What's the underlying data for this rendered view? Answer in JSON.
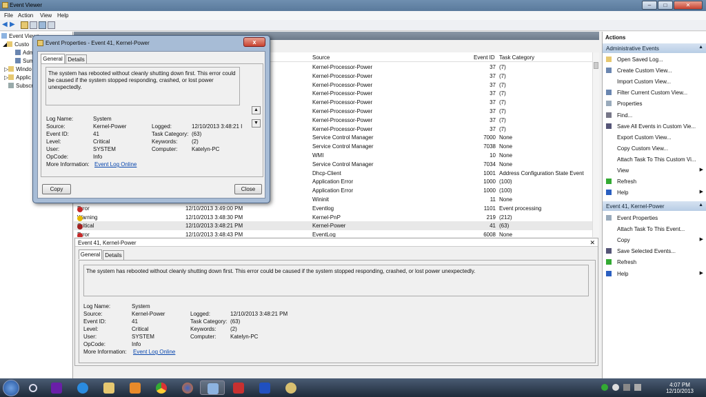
{
  "window": {
    "title": "Event Viewer"
  },
  "menu": [
    "File",
    "Action",
    "View",
    "Help"
  ],
  "tree": [
    {
      "label": "Event Viewe",
      "indent": 2
    },
    {
      "label": "Custo",
      "indent": 10
    },
    {
      "label": "Admi",
      "indent": 22
    },
    {
      "label": "Sum",
      "indent": 22
    },
    {
      "label": "Windo",
      "indent": 10
    },
    {
      "label": "Applic",
      "indent": 10
    },
    {
      "label": "Subscri",
      "indent": 10
    }
  ],
  "grid": {
    "columns": {
      "source": "Source",
      "event_id": "Event ID",
      "task_category": "Task Category"
    },
    "rows": [
      {
        "level": "",
        "date": "",
        "source": "Kernel-Processor-Power",
        "id": "37",
        "task": "(7)"
      },
      {
        "level": "",
        "date": "",
        "source": "Kernel-Processor-Power",
        "id": "37",
        "task": "(7)"
      },
      {
        "level": "",
        "date": "",
        "source": "Kernel-Processor-Power",
        "id": "37",
        "task": "(7)"
      },
      {
        "level": "",
        "date": "",
        "source": "Kernel-Processor-Power",
        "id": "37",
        "task": "(7)"
      },
      {
        "level": "",
        "date": "",
        "source": "Kernel-Processor-Power",
        "id": "37",
        "task": "(7)"
      },
      {
        "level": "",
        "date": "",
        "source": "Kernel-Processor-Power",
        "id": "37",
        "task": "(7)"
      },
      {
        "level": "",
        "date": "",
        "source": "Kernel-Processor-Power",
        "id": "37",
        "task": "(7)"
      },
      {
        "level": "",
        "date": "",
        "source": "Kernel-Processor-Power",
        "id": "37",
        "task": "(7)"
      },
      {
        "level": "",
        "date": "",
        "source": "Service Control Manager",
        "id": "7000",
        "task": "None"
      },
      {
        "level": "",
        "date": "",
        "source": "Service Control Manager",
        "id": "7038",
        "task": "None"
      },
      {
        "level": "",
        "date": "",
        "source": "WMI",
        "id": "10",
        "task": "None"
      },
      {
        "level": "",
        "date": "",
        "source": "Service Control Manager",
        "id": "7034",
        "task": "None"
      },
      {
        "level": "",
        "date": "",
        "source": "Dhcp-Client",
        "id": "1001",
        "task": "Address Configuration State Event"
      },
      {
        "level": "",
        "date": "",
        "source": "Application Error",
        "id": "1000",
        "task": "(100)"
      },
      {
        "level": "",
        "date": "",
        "source": "Application Error",
        "id": "1000",
        "task": "(100)"
      },
      {
        "level": "",
        "date": "",
        "source": "Wininit",
        "id": "11",
        "task": "None"
      },
      {
        "level": "Error",
        "date": "12/10/2013 3:49:00 PM",
        "source": "Eventlog",
        "id": "1101",
        "task": "Event processing",
        "icon": "error"
      },
      {
        "level": "Warning",
        "date": "12/10/2013 3:48:30 PM",
        "source": "Kernel-PnP",
        "id": "219",
        "task": "(212)",
        "icon": "warning"
      },
      {
        "level": "Critical",
        "date": "12/10/2013 3:48:21 PM",
        "source": "Kernel-Power",
        "id": "41",
        "task": "(63)",
        "icon": "critical"
      },
      {
        "level": "Error",
        "date": "12/10/2013 3:48:43 PM",
        "source": "EventLog",
        "id": "6008",
        "task": "None",
        "icon": "error"
      }
    ]
  },
  "detail": {
    "title": "Event 41, Kernel-Power",
    "tabs": [
      "General",
      "Details"
    ],
    "message": "The system has rebooted without cleanly shutting down first. This error could be caused if the system stopped responding, crashed, or lost power unexpectedly.",
    "labels": {
      "log_name": "Log Name:",
      "source": "Source:",
      "event_id": "Event ID:",
      "level": "Level:",
      "user": "User:",
      "opcode": "OpCode:",
      "more_info": "More Information:",
      "logged": "Logged:",
      "task_category": "Task Category:",
      "keywords": "Keywords:",
      "computer": "Computer:"
    },
    "values": {
      "log_name": "System",
      "source": "Kernel-Power",
      "event_id": "41",
      "level": "Critical",
      "user": "SYSTEM",
      "opcode": "Info",
      "more_info": "Event Log Online",
      "logged": "12/10/2013 3:48:21 PM",
      "task_category": "(63)",
      "keywords": "(2)",
      "computer": "Katelyn-PC"
    }
  },
  "dialog": {
    "title": "Event Properties - Event 41, Kernel-Power",
    "close_x": "x",
    "tabs": [
      "General",
      "Details"
    ],
    "message": "The system has rebooted without cleanly shutting down first. This error could be caused if the system stopped responding, crashed, or lost power unexpectedly.",
    "logged_truncated": "12/10/2013 3:48:21 I",
    "copy": "Copy",
    "close": "Close"
  },
  "actions": {
    "title": "Actions",
    "section1": "Administrative Events",
    "items1": [
      "Open Saved Log...",
      "Create Custom View...",
      "Import Custom View...",
      "Filter Current Custom View...",
      "Properties",
      "Find...",
      "Save All Events in Custom Vie...",
      "Export Custom View...",
      "Copy Custom View...",
      "Attach Task To This Custom Vi...",
      "View",
      "Refresh",
      "Help"
    ],
    "section2": "Event 41, Kernel-Power",
    "items2": [
      "Event Properties",
      "Attach Task To This Event...",
      "Copy",
      "Save Selected Events...",
      "Refresh",
      "Help"
    ]
  },
  "taskbar": {
    "time": "4:07 PM",
    "date": "12/10/2013"
  }
}
